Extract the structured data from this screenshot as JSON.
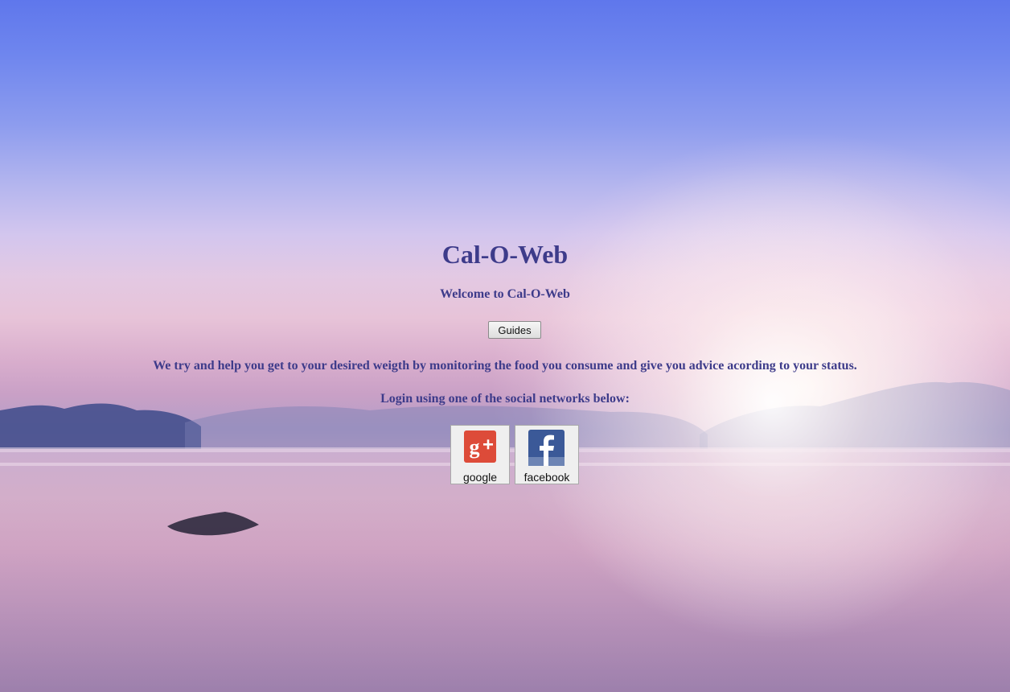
{
  "page": {
    "title": "Cal-O-Web",
    "welcome": "Welcome to Cal-O-Web",
    "guides_button": "Guides",
    "description": "We try and help you get to your desired weigth by monitoring the food you consume and give you advice acording to your status.",
    "login_prompt": "Login using one of the social networks below:"
  },
  "social": {
    "google": {
      "label": "google",
      "icon": "google-plus-icon",
      "color": "#dd4b39"
    },
    "facebook": {
      "label": "facebook",
      "icon": "facebook-icon",
      "color": "#3b5998"
    }
  },
  "colors": {
    "text": "#3d3b8a",
    "sky_top": "#5f77ec"
  }
}
